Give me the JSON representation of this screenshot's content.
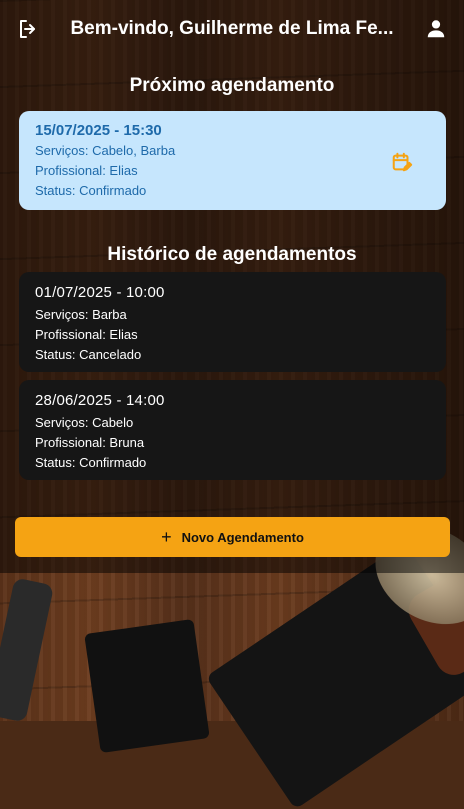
{
  "header": {
    "title": "Bem-vindo, Guilherme de Lima Fe...",
    "logout_icon": "logout-icon",
    "profile_icon": "person-icon"
  },
  "next": {
    "section_title": "Próximo agendamento",
    "datetime": "15/07/2025 - 15:30",
    "services": "Serviços: Cabelo, Barba",
    "professional": "Profissional: Elias",
    "status": "Status: Confirmado",
    "edit_icon": "calendar-edit-icon"
  },
  "history": {
    "section_title": "Histórico de agendamentos",
    "items": [
      {
        "datetime": "01/07/2025 - 10:00",
        "services": "Serviços: Barba",
        "professional": "Profissional: Elias",
        "status": "Status: Cancelado"
      },
      {
        "datetime": "28/06/2025 - 14:00",
        "services": "Serviços: Cabelo",
        "professional": "Profissional: Bruna",
        "status": "Status: Confirmado"
      }
    ]
  },
  "new_button": {
    "label": "Novo Agendamento",
    "icon": "plus-icon"
  },
  "colors": {
    "accent": "#f5a313",
    "next_card_bg": "#c6e6fd",
    "next_card_text": "#1e6aaa",
    "history_card_bg": "#161616"
  }
}
